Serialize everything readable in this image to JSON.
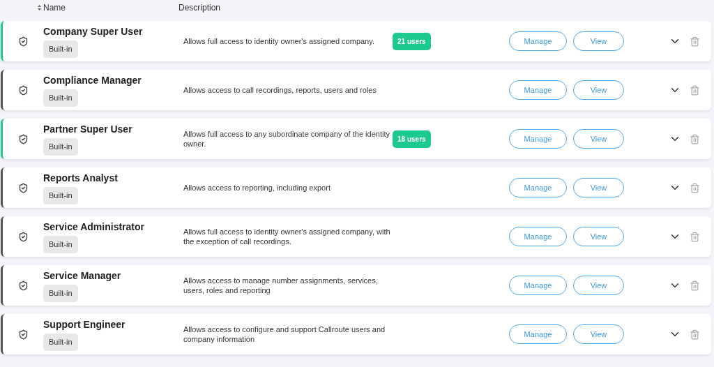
{
  "columns": [
    "Name",
    "Description"
  ],
  "rows": [
    {
      "name": "Company Super User",
      "tag": "Built-in",
      "description": "Allows full access to identity owner's assigned company.",
      "users": "21 users",
      "color": "#1cc98e",
      "actions": [
        "Manage",
        "View"
      ]
    },
    {
      "name": "Compliance Manager",
      "tag": "Built-in",
      "description": "Allows access to call recordings, reports, users and roles",
      "color": "#555555",
      "actions": [
        "Manage",
        "View"
      ]
    },
    {
      "name": "Partner Super User",
      "tag": "Built-in",
      "description": "Allows full access to any subordinate company of the identity owner.",
      "users": "18 users",
      "color": "#1cc98e",
      "actions": [
        "Manage",
        "View"
      ]
    },
    {
      "name": "Reports Analyst",
      "tag": "Built-in",
      "description": "Allows access to reporting, including export",
      "color": "#555555",
      "actions": [
        "Manage",
        "View"
      ]
    },
    {
      "name": "Service Administrator",
      "tag": "Built-in",
      "description": "Allows full access to identity owner's assigned company, with the exception of call recordings.",
      "color": "#555555",
      "actions": [
        "Manage",
        "View"
      ]
    },
    {
      "name": "Service Manager",
      "tag": "Built-in",
      "description": "Allows access to manage number assignments, services, users, roles and reporting",
      "color": "#555555",
      "actions": [
        "Manage",
        "View"
      ]
    },
    {
      "name": "Support Engineer",
      "tag": "Built-in",
      "description": "Allows access to configure and support Callroute users and company information",
      "color": "#555555",
      "actions": [
        "Manage",
        "View"
      ]
    }
  ]
}
